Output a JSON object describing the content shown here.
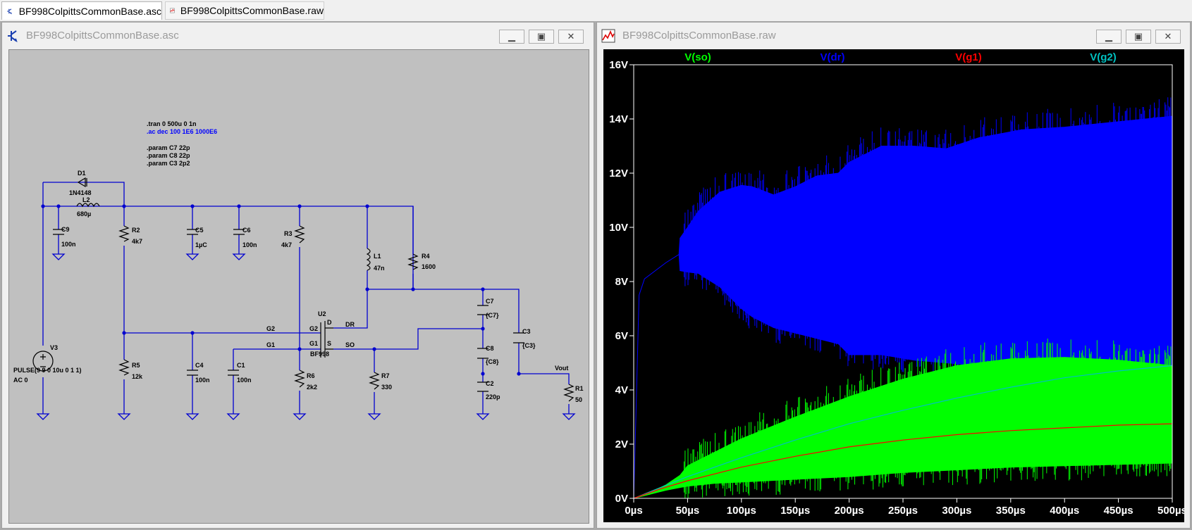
{
  "tabs": [
    {
      "label": "BF998ColpittsCommonBase.asc",
      "icon": "schematic-icon",
      "active": true
    },
    {
      "label": "BF998ColpittsCommonBase.raw",
      "icon": "waveform-icon",
      "active": false
    }
  ],
  "schematic_window": {
    "title": "BF998ColpittsCommonBase.asc",
    "directives": [
      ".tran 0 500u 0 1n",
      ".ac dec 100 1E6 1000E6",
      ".param C7 22p",
      ".param C8 22p",
      ".param C3 2p2"
    ],
    "components": {
      "D1": {
        "ref": "D1",
        "value": "1N4148"
      },
      "L2": {
        "ref": "L2",
        "value": "680µ"
      },
      "C9": {
        "ref": "C9",
        "value": "100n"
      },
      "R2": {
        "ref": "R2",
        "value": "4k7"
      },
      "C5": {
        "ref": "C5",
        "value": "1µC"
      },
      "C6": {
        "ref": "C6",
        "value": "100n"
      },
      "R3": {
        "ref": "R3",
        "value": "4k7"
      },
      "L1": {
        "ref": "L1",
        "value": "47n"
      },
      "R4": {
        "ref": "R4",
        "value": "1600"
      },
      "U2": {
        "ref": "U2",
        "value": "BF998"
      },
      "C7": {
        "ref": "C7",
        "value": "{C7}"
      },
      "C3": {
        "ref": "C3",
        "value": "{C3}"
      },
      "C8": {
        "ref": "C8",
        "value": "{C8}"
      },
      "C2": {
        "ref": "C2",
        "value": "220p"
      },
      "V3": {
        "ref": "V3",
        "value": "PULSE(9 9 0 10u 0 1 1)",
        "ac": "AC 0"
      },
      "R5": {
        "ref": "R5",
        "value": "12k"
      },
      "C4": {
        "ref": "C4",
        "value": "100n"
      },
      "C1": {
        "ref": "C1",
        "value": "100n"
      },
      "R6": {
        "ref": "R6",
        "value": "2k2"
      },
      "R7": {
        "ref": "R7",
        "value": "330"
      },
      "R1": {
        "ref": "R1",
        "value": "50"
      }
    },
    "net_labels": {
      "g2": "G2",
      "g1": "G1",
      "pin_g2": "G2",
      "pin_g1": "G1",
      "pin_d": "D",
      "pin_s": "S",
      "dr": "DR",
      "so": "SO",
      "vout": "Vout"
    },
    "colors": {
      "wire": "#0000d0",
      "background": "#c0c0c0",
      "ac_directive": "#0000ff"
    }
  },
  "waveform_window": {
    "title": "BF998ColpittsCommonBase.raw",
    "traces": [
      {
        "label": "V(so)",
        "color": "#00ff00"
      },
      {
        "label": "V(dr)",
        "color": "#0000ff"
      },
      {
        "label": "V(g1)",
        "color": "#ff0000"
      },
      {
        "label": "V(g2)",
        "color": "#00c0c0"
      }
    ],
    "y_ticks": [
      "0V",
      "2V",
      "4V",
      "6V",
      "8V",
      "10V",
      "12V",
      "14V",
      "16V"
    ],
    "x_ticks": [
      "0µs",
      "50µs",
      "100µs",
      "150µs",
      "200µs",
      "250µs",
      "300µs",
      "350µs",
      "400µs",
      "450µs",
      "500µs"
    ],
    "colors": {
      "background": "#000000",
      "axis": "#ffffff",
      "text": "#ffffff"
    }
  },
  "chart_data": {
    "type": "line",
    "title": "",
    "xlabel": "",
    "ylabel": "",
    "xlim": [
      0,
      500
    ],
    "ylim": [
      0,
      16
    ],
    "x_unit": "µs",
    "y_unit": "V",
    "grid": false,
    "legend": "top",
    "series": [
      {
        "name": "V(dr)",
        "kind": "envelope",
        "x": [
          0,
          2,
          5,
          10,
          20,
          30,
          42,
          43,
          50,
          60,
          80,
          100,
          110,
          130,
          150,
          170,
          190,
          200,
          230,
          260,
          290,
          320,
          360,
          400,
          450,
          500
        ],
        "upper": [
          0,
          3,
          7.5,
          8.1,
          8.4,
          8.7,
          9.0,
          9.6,
          10.0,
          10.6,
          11.3,
          11.55,
          11.5,
          11.2,
          11.5,
          11.9,
          12.0,
          12.4,
          13.0,
          13.0,
          12.9,
          13.3,
          13.6,
          13.7,
          13.9,
          14.1
        ],
        "lower": [
          0,
          3,
          7.5,
          8.1,
          8.4,
          8.7,
          9.0,
          8.4,
          8.35,
          8.3,
          7.8,
          7.0,
          6.7,
          6.3,
          6.1,
          5.9,
          5.7,
          5.3,
          5.3,
          5.1,
          5.0,
          4.9,
          4.8,
          4.7,
          4.6,
          4.5
        ]
      },
      {
        "name": "V(so)",
        "kind": "envelope",
        "x": [
          0,
          10,
          20,
          30,
          43,
          50,
          75,
          100,
          150,
          200,
          250,
          300,
          350,
          400,
          450,
          500
        ],
        "upper": [
          0,
          0.15,
          0.3,
          0.5,
          0.85,
          1.2,
          1.7,
          2.2,
          3.0,
          3.75,
          4.4,
          4.9,
          5.15,
          5.2,
          5.1,
          4.9
        ],
        "lower": [
          0,
          0.1,
          0.2,
          0.3,
          0.4,
          0.45,
          0.55,
          0.6,
          0.7,
          0.8,
          0.95,
          1.05,
          1.15,
          1.2,
          1.25,
          1.3
        ]
      },
      {
        "name": "V(g1)",
        "kind": "line",
        "x": [
          0,
          25,
          50,
          100,
          150,
          200,
          250,
          300,
          350,
          400,
          450,
          500
        ],
        "values": [
          0,
          0.35,
          0.65,
          1.15,
          1.55,
          1.9,
          2.15,
          2.35,
          2.5,
          2.6,
          2.7,
          2.75
        ]
      },
      {
        "name": "V(g2)",
        "kind": "line",
        "x": [
          0,
          25,
          50,
          100,
          150,
          200,
          250,
          300,
          350,
          400,
          450,
          500
        ],
        "values": [
          0,
          0.4,
          0.8,
          1.5,
          2.15,
          2.75,
          3.25,
          3.7,
          4.1,
          4.45,
          4.7,
          4.9
        ]
      }
    ]
  }
}
